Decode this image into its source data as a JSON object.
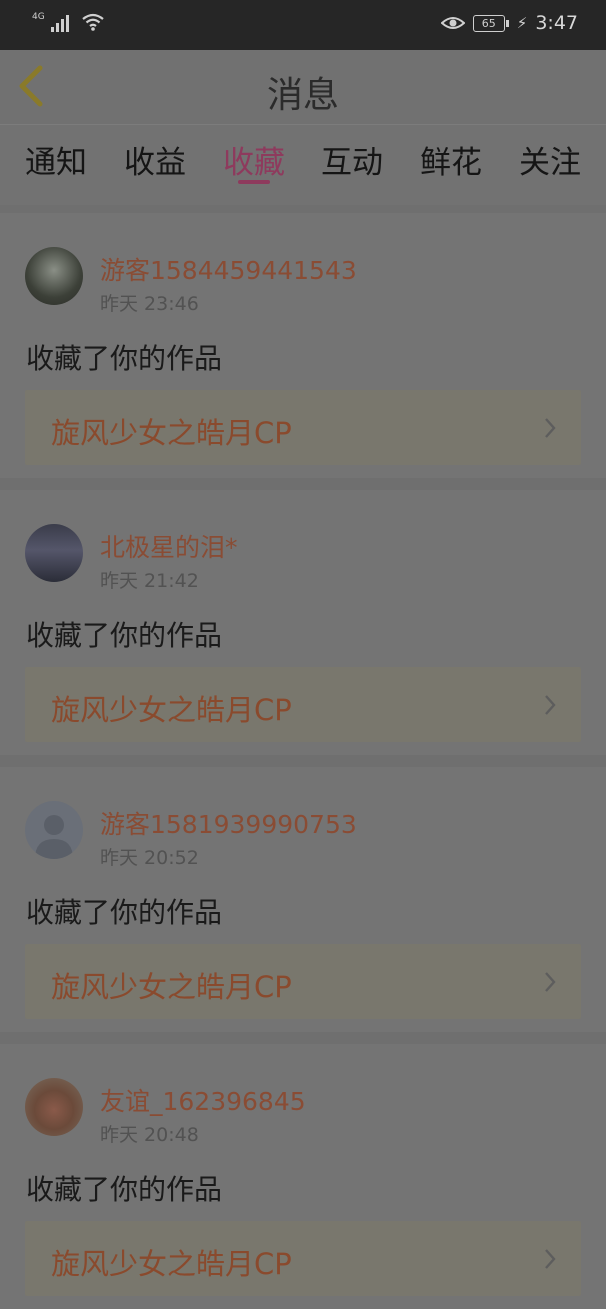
{
  "status_bar": {
    "network": "4G",
    "battery": "65",
    "time": "3:47"
  },
  "header": {
    "title": "消息"
  },
  "tabs": [
    {
      "label": "通知"
    },
    {
      "label": "收益"
    },
    {
      "label": "收藏"
    },
    {
      "label": "互动"
    },
    {
      "label": "鲜花"
    },
    {
      "label": "关注"
    }
  ],
  "active_tab": "收藏",
  "notifications": [
    {
      "user": "游客1584459441543",
      "time": "昨天 23:46",
      "action": "收藏了你的作品",
      "work": "旋风少女之皓月CP"
    },
    {
      "user": "北极星的泪*",
      "time": "昨天 21:42",
      "action": "收藏了你的作品",
      "work": "旋风少女之皓月CP"
    },
    {
      "user": "游客1581939990753",
      "time": "昨天 20:52",
      "action": "收藏了你的作品",
      "work": "旋风少女之皓月CP"
    },
    {
      "user": "友谊_162396845",
      "time": "昨天 20:48",
      "action": "收藏了你的作品",
      "work": "旋风少女之皓月CP"
    }
  ],
  "colors": {
    "accent": "#8e3a5d",
    "username": "#8a4c34",
    "overlay_bg": "#717171"
  }
}
